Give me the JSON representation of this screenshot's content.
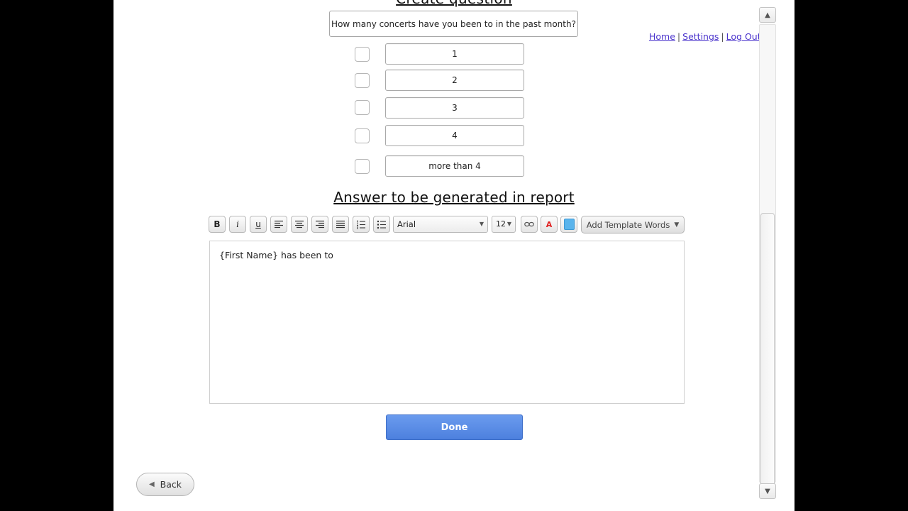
{
  "header": {
    "create_title": "Create question",
    "nav": {
      "home": "Home",
      "settings": "Settings",
      "logout": "Log Out",
      "separator": "|"
    }
  },
  "question": {
    "text": "How many concerts have you been to in the past month?"
  },
  "options": [
    {
      "label": "1",
      "checked": false
    },
    {
      "label": "2",
      "checked": false
    },
    {
      "label": "3",
      "checked": false
    },
    {
      "label": "4",
      "checked": false
    },
    {
      "label": "more than 4",
      "checked": false
    }
  ],
  "answer_section": {
    "title": "Answer to be generated in report",
    "toolbar": {
      "bold": "B",
      "italic": "i",
      "underline": "u",
      "font": "Arial",
      "font_size": "12",
      "text_color_label": "A",
      "text_color": "#e02020",
      "highlight_color": "#5ab4ec",
      "add_template_words": "Add Template Words"
    },
    "editor_text": "{First Name} has been to"
  },
  "buttons": {
    "done": "Done",
    "back": "Back"
  },
  "colors": {
    "done_button": "#5a8ce6",
    "link": "#4a33cc"
  }
}
